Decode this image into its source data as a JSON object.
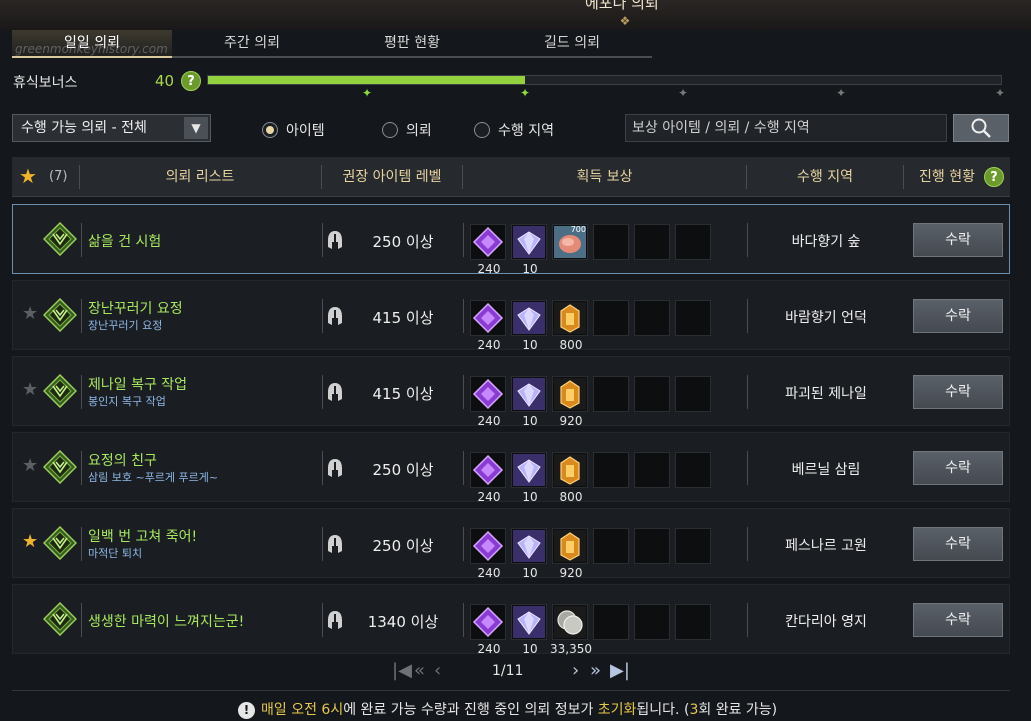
{
  "window": {
    "title": "에포나 의뢰",
    "watermark": "greenmonkeyhistory.com"
  },
  "tabs": [
    {
      "label": "일일 의뢰",
      "active": true
    },
    {
      "label": "주간 의뢰",
      "active": false
    },
    {
      "label": "평판 현황",
      "active": false
    },
    {
      "label": "길드 의뢰",
      "active": false
    }
  ],
  "rest_bonus": {
    "label": "휴식보너스",
    "value": "40",
    "help": "?",
    "progress_fraction": 0.4
  },
  "filter": {
    "select_value": "수행 가능 의뢰 - 전체",
    "radios": [
      {
        "label": "아이템",
        "checked": true
      },
      {
        "label": "의뢰",
        "checked": false
      },
      {
        "label": "수행 지역",
        "checked": false
      }
    ],
    "search_placeholder": "보상 아이템 / 의뢰 / 수행 지역"
  },
  "table": {
    "star_count": "(7)",
    "headers": {
      "list": "의뢰 리스트",
      "level": "권장 아이템 레벨",
      "reward": "획득 보상",
      "region": "수행 지역",
      "status": "진행 현황"
    },
    "rows": [
      {
        "starred": null,
        "name": "삶을 건 시험",
        "sub": "",
        "level": "250 이상",
        "rewards": [
          {
            "type": "purple",
            "count": "240"
          },
          {
            "type": "crystal",
            "count": "10"
          },
          {
            "type": "meat",
            "count": "",
            "badge": "700"
          }
        ],
        "region": "바다향기 숲",
        "action": "수락",
        "selected": true
      },
      {
        "starred": false,
        "name": "장난꾸러기 요정",
        "sub": "장난꾸러기 요정",
        "level": "415 이상",
        "rewards": [
          {
            "type": "purple",
            "count": "240"
          },
          {
            "type": "crystal",
            "count": "10"
          },
          {
            "type": "gold",
            "count": "800"
          }
        ],
        "region": "바람향기 언덕",
        "action": "수락",
        "selected": false
      },
      {
        "starred": false,
        "name": "제나일 복구 작업",
        "sub": "봉인지 복구 작업",
        "level": "415 이상",
        "rewards": [
          {
            "type": "purple",
            "count": "240"
          },
          {
            "type": "crystal",
            "count": "10"
          },
          {
            "type": "gold",
            "count": "920"
          }
        ],
        "region": "파괴된 제나일",
        "action": "수락",
        "selected": false
      },
      {
        "starred": false,
        "name": "요정의 친구",
        "sub": "삼림 보호 ~푸르게 푸르게~",
        "level": "250 이상",
        "rewards": [
          {
            "type": "purple",
            "count": "240"
          },
          {
            "type": "crystal",
            "count": "10"
          },
          {
            "type": "gold",
            "count": "800"
          }
        ],
        "region": "베르닐 삼림",
        "action": "수락",
        "selected": false
      },
      {
        "starred": true,
        "name": "일백 번 고쳐 죽어!",
        "sub": "마적단 퇴치",
        "level": "250 이상",
        "rewards": [
          {
            "type": "purple",
            "count": "240"
          },
          {
            "type": "crystal",
            "count": "10"
          },
          {
            "type": "gold",
            "count": "920"
          }
        ],
        "region": "페스나르 고원",
        "action": "수락",
        "selected": false
      },
      {
        "starred": null,
        "name": "생생한 마력이 느껴지는군!",
        "sub": "",
        "level": "1340 이상",
        "rewards": [
          {
            "type": "purple",
            "count": "240"
          },
          {
            "type": "crystal",
            "count": "10"
          },
          {
            "type": "silver",
            "count": "33,350"
          }
        ],
        "region": "칸다리아 영지",
        "action": "수락",
        "selected": false
      }
    ]
  },
  "pagination": {
    "text": "1/11"
  },
  "notice": {
    "icon": "!",
    "parts": [
      {
        "text": "매일 오전 6시",
        "hl": true
      },
      {
        "text": "에 완료 가능 수량과 진행 중인 의뢰 정보가 ",
        "hl": false
      },
      {
        "text": "초기화",
        "hl": true
      },
      {
        "text": "됩니다. (",
        "hl": false
      },
      {
        "text": "3",
        "hl": true
      },
      {
        "text": "회 완료 가능)",
        "hl": false
      }
    ]
  },
  "colors": {
    "accent_green": "#93d13e",
    "quest_name": "#a8e85e",
    "header_gold": "#e8d3a0",
    "highlight": "#e6c84a"
  }
}
